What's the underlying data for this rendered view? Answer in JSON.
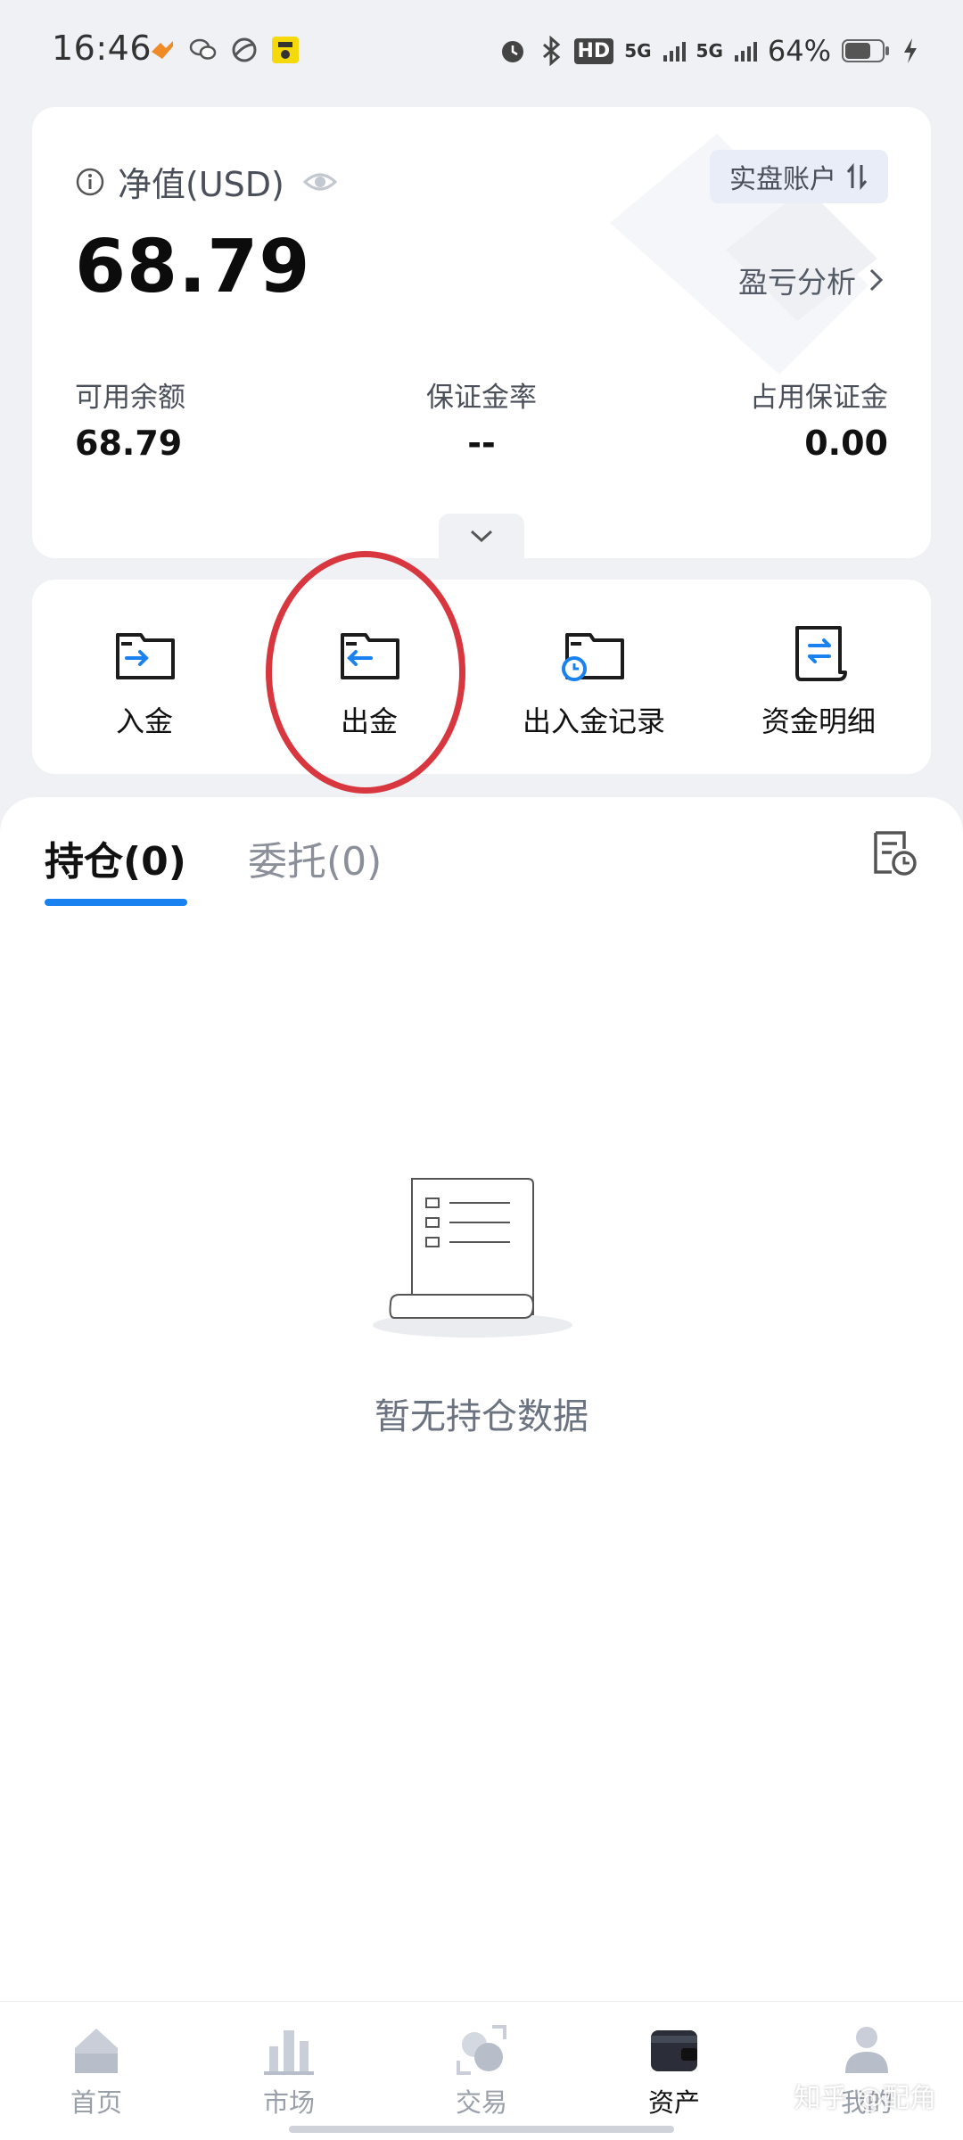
{
  "status_bar": {
    "time": "16:46",
    "left_icons": [
      "heart-app-icon",
      "wechat-icon",
      "swirl-app-icon",
      "qq-app-icon"
    ],
    "network_hd": "HD",
    "signal_1": "5G",
    "signal_2": "5G",
    "battery": "64%"
  },
  "summary": {
    "net_value_label": "净值(USD)",
    "account_type_label": "实盘账户",
    "net_value": "68.79",
    "pnl_analysis_label": "盈亏分析",
    "stats": [
      {
        "label": "可用余额",
        "value": "68.79"
      },
      {
        "label": "保证金率",
        "value": "--"
      },
      {
        "label": "占用保证金",
        "value": "0.00"
      }
    ]
  },
  "actions": [
    {
      "label": "入金",
      "icon": "deposit-icon"
    },
    {
      "label": "出金",
      "icon": "withdraw-icon"
    },
    {
      "label": "出入金记录",
      "icon": "fund-records-icon"
    },
    {
      "label": "资金明细",
      "icon": "fund-details-icon"
    }
  ],
  "tabs": {
    "positions_label": "持仓(0)",
    "orders_label": "委托(0)"
  },
  "empty_state": {
    "message": "暂无持仓数据"
  },
  "bottom_nav": [
    {
      "label": "首页",
      "icon": "home-icon",
      "active": false
    },
    {
      "label": "市场",
      "icon": "market-chart-icon",
      "active": false
    },
    {
      "label": "交易",
      "icon": "trade-icon",
      "active": false
    },
    {
      "label": "资产",
      "icon": "wallet-icon",
      "active": true
    },
    {
      "label": "我的",
      "icon": "profile-icon",
      "active": false
    }
  ],
  "corner_watermark": "知乎 @配角",
  "colors": {
    "accent_blue": "#1a82f0",
    "highlight_red": "#d8373f",
    "background": "#eff1f5"
  }
}
